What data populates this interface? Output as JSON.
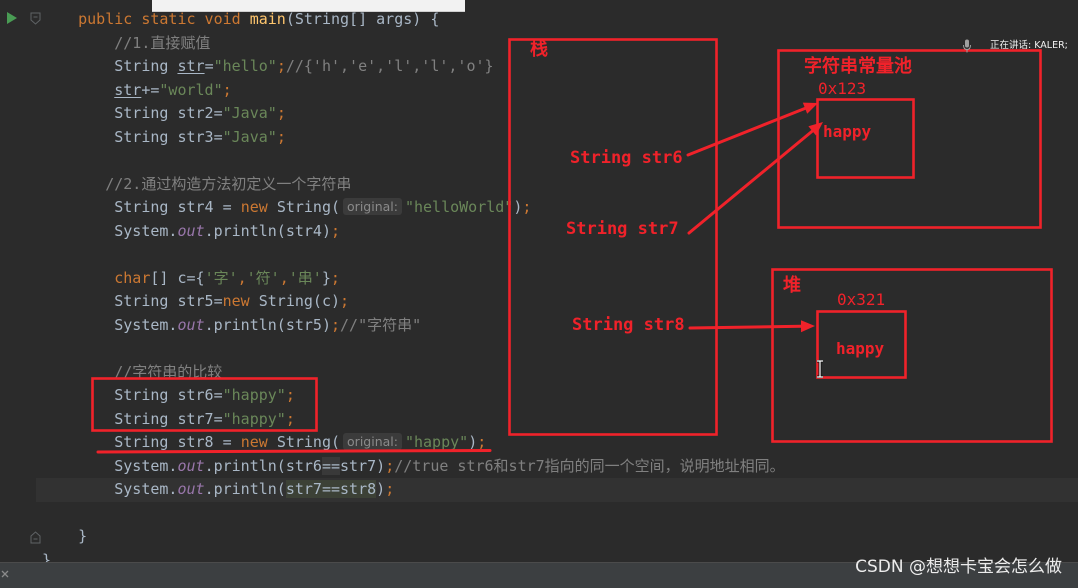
{
  "editor": {
    "lines": [
      {
        "tokens": [
          {
            "t": "    public static void ",
            "c": "kw"
          },
          {
            "t": "main",
            "c": "fn"
          },
          {
            "t": "(String[] args) {",
            "c": "p"
          }
        ]
      },
      {
        "tokens": [
          {
            "t": "        //1.直接赋值",
            "c": "cm"
          }
        ]
      },
      {
        "tokens": [
          {
            "t": "        String ",
            "c": "p"
          },
          {
            "t": "str",
            "c": "var"
          },
          {
            "t": "=",
            "c": "p"
          },
          {
            "t": "\"hello\"",
            "c": "str"
          },
          {
            "t": ";",
            "c": "kw"
          },
          {
            "t": "//{'h','e','l','l','o'}",
            "c": "cm"
          }
        ]
      },
      {
        "tokens": [
          {
            "t": "        ",
            "c": "p"
          },
          {
            "t": "str",
            "c": "var"
          },
          {
            "t": "+=",
            "c": "p"
          },
          {
            "t": "\"world\"",
            "c": "str"
          },
          {
            "t": ";",
            "c": "kw"
          }
        ]
      },
      {
        "tokens": [
          {
            "t": "        String str2=",
            "c": "p"
          },
          {
            "t": "\"Java\"",
            "c": "str"
          },
          {
            "t": ";",
            "c": "kw"
          }
        ]
      },
      {
        "tokens": [
          {
            "t": "        String str3=",
            "c": "p"
          },
          {
            "t": "\"Java\"",
            "c": "str"
          },
          {
            "t": ";",
            "c": "kw"
          }
        ]
      },
      {
        "tokens": []
      },
      {
        "tokens": [
          {
            "t": "       //2.通过构造方法初定义一个字符串",
            "c": "cm"
          }
        ]
      },
      {
        "tokens": [
          {
            "t": "        String str4 = ",
            "c": "p"
          },
          {
            "t": "new ",
            "c": "kw"
          },
          {
            "t": "String(",
            "c": "p"
          },
          {
            "t": "original:",
            "c": "hint"
          },
          {
            "t": "\"helloWorld\"",
            "c": "str"
          },
          {
            "t": ")",
            "c": "p"
          },
          {
            "t": ";",
            "c": "kw"
          }
        ]
      },
      {
        "tokens": [
          {
            "t": "        System.",
            "c": "p"
          },
          {
            "t": "out",
            "c": "fld"
          },
          {
            "t": ".println(str4)",
            "c": "p"
          },
          {
            "t": ";",
            "c": "kw"
          }
        ]
      },
      {
        "tokens": []
      },
      {
        "tokens": [
          {
            "t": "        ",
            "c": "p"
          },
          {
            "t": "char",
            "c": "kw"
          },
          {
            "t": "[] c={",
            "c": "p"
          },
          {
            "t": "'字'",
            "c": "str"
          },
          {
            "t": ",",
            "c": "kw"
          },
          {
            "t": "'符'",
            "c": "str"
          },
          {
            "t": ",",
            "c": "kw"
          },
          {
            "t": "'串'",
            "c": "str"
          },
          {
            "t": "}",
            "c": "p"
          },
          {
            "t": ";",
            "c": "kw"
          }
        ]
      },
      {
        "tokens": [
          {
            "t": "        String str5=",
            "c": "p"
          },
          {
            "t": "new ",
            "c": "kw"
          },
          {
            "t": "String(c)",
            "c": "p"
          },
          {
            "t": ";",
            "c": "kw"
          }
        ]
      },
      {
        "tokens": [
          {
            "t": "        System.",
            "c": "p"
          },
          {
            "t": "out",
            "c": "fld"
          },
          {
            "t": ".println(str5)",
            "c": "p"
          },
          {
            "t": ";",
            "c": "kw"
          },
          {
            "t": "//\"字符串\"",
            "c": "cm"
          }
        ]
      },
      {
        "tokens": []
      },
      {
        "tokens": [
          {
            "t": "        //字符串的比较",
            "c": "cm"
          }
        ]
      },
      {
        "tokens": [
          {
            "t": "        String str6=",
            "c": "p"
          },
          {
            "t": "\"happy\"",
            "c": "str"
          },
          {
            "t": ";",
            "c": "kw"
          }
        ]
      },
      {
        "tokens": [
          {
            "t": "        String str7=",
            "c": "p"
          },
          {
            "t": "\"happy\"",
            "c": "str"
          },
          {
            "t": ";",
            "c": "kw"
          }
        ]
      },
      {
        "tokens": [
          {
            "t": "        String str8 = ",
            "c": "p"
          },
          {
            "t": "new ",
            "c": "kw"
          },
          {
            "t": "String(",
            "c": "p"
          },
          {
            "t": "original:",
            "c": "hint"
          },
          {
            "t": "\"happy\"",
            "c": "str"
          },
          {
            "t": ")",
            "c": "p"
          },
          {
            "t": ";",
            "c": "kw"
          }
        ]
      },
      {
        "tokens": [
          {
            "t": "        System.",
            "c": "p"
          },
          {
            "t": "out",
            "c": "fld"
          },
          {
            "t": ".println(str6",
            "c": "p"
          },
          {
            "t": "==",
            "c": "hl2"
          },
          {
            "t": "str7)",
            "c": "p"
          },
          {
            "t": ";",
            "c": "kw"
          },
          {
            "t": "//true str6和str7指向的同一个空间，说明地址相同。",
            "c": "cm"
          }
        ]
      },
      {
        "tokens": [
          {
            "t": "        System.",
            "c": "p"
          },
          {
            "t": "out",
            "c": "fld"
          },
          {
            "t": ".println(",
            "c": "p"
          },
          {
            "t": "str7==str8",
            "c": "hl"
          },
          {
            "t": ")",
            "c": "p"
          },
          {
            "t": ";",
            "c": "kw"
          }
        ]
      },
      {
        "tokens": []
      },
      {
        "tokens": [
          {
            "t": "    }",
            "c": "p"
          }
        ]
      },
      {
        "tokens": [
          {
            "t": "}",
            "c": "p"
          }
        ]
      }
    ]
  },
  "annotations": {
    "stack": {
      "label": "栈",
      "vars": [
        "String str6",
        "String str7",
        "String str8"
      ]
    },
    "string_pool": {
      "label": "字符串常量池",
      "address": "0x123",
      "value": "happy"
    },
    "heap": {
      "label": "堆",
      "address": "0x321",
      "value": "happy"
    }
  },
  "voice_indicator": {
    "text": "正在讲话: KALER;",
    "icon": "microphone-icon"
  },
  "watermark": "CSDN @想想卡宝会怎么做",
  "icons": {
    "run": "run-icon",
    "fold": "fold-marker-icon",
    "close": "close-icon",
    "cursor": "text-cursor-icon",
    "microphone": "microphone-icon"
  },
  "colors": {
    "background": "#2b2b2b",
    "plain": "#a9b7c6",
    "keyword": "#cc7832",
    "string": "#6a8759",
    "comment": "#808080",
    "method": "#ffc66d",
    "static-field": "#9876aa",
    "annotation-red": "#f0222a",
    "run-green": "#499c54"
  }
}
